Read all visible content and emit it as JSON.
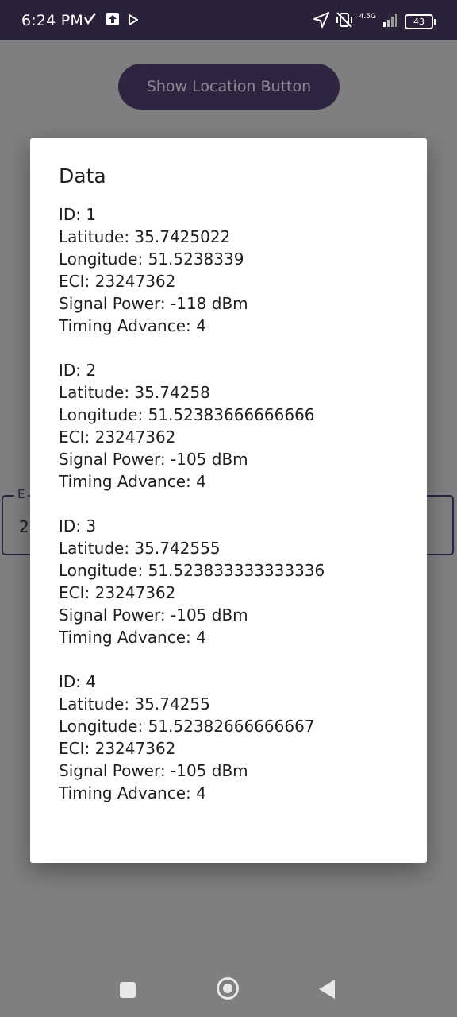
{
  "status_bar": {
    "time": "6:24 PM",
    "network_label": "4.5G",
    "battery": "43",
    "icons": [
      "check-icon",
      "upload-icon",
      "play-icon",
      "location-arrow-icon",
      "vibrate-off-icon",
      "signal-icon",
      "battery-icon"
    ]
  },
  "main": {
    "show_location_button": "Show Location Button",
    "text_field_label": "E",
    "text_field_value": "2"
  },
  "dialog": {
    "title": "Data",
    "records": [
      {
        "id": "ID: 1",
        "latitude": "Latitude: 35.7425022",
        "longitude": "Longitude: 51.5238339",
        "eci": "ECI: 23247362",
        "signal_power": "Signal Power: -118 dBm",
        "timing_advance": "Timing Advance: 4"
      },
      {
        "id": "ID: 2",
        "latitude": "Latitude: 35.74258",
        "longitude": "Longitude: 51.52383666666666",
        "eci": "ECI: 23247362",
        "signal_power": "Signal Power: -105 dBm",
        "timing_advance": "Timing Advance: 4"
      },
      {
        "id": "ID: 3",
        "latitude": "Latitude: 35.742555",
        "longitude": "Longitude: 51.523833333333336",
        "eci": "ECI: 23247362",
        "signal_power": "Signal Power: -105 dBm",
        "timing_advance": "Timing Advance: 4"
      },
      {
        "id": "ID: 4",
        "latitude": "Latitude: 35.74255",
        "longitude": "Longitude: 51.52382666666667",
        "eci": "ECI: 23247362",
        "signal_power": "Signal Power: -105 dBm",
        "timing_advance": "Timing Advance: 4"
      }
    ]
  },
  "nav_bar": {
    "buttons": [
      "recents-square-icon",
      "home-circle-icon",
      "back-triangle-icon"
    ]
  }
}
